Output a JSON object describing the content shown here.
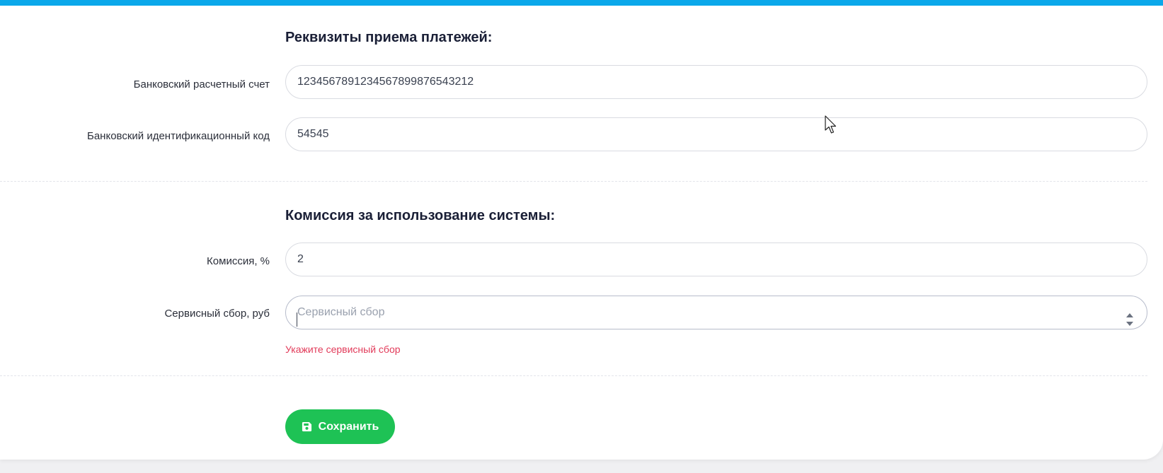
{
  "colors": {
    "accent_bar": "#0ba8ea",
    "save_button": "#1ec255",
    "error": "#e23b5a"
  },
  "payment_details": {
    "title": "Реквизиты приема платежей:",
    "account_label": "Банковский расчетный счет",
    "account_value": "12345678912345678998765432​12",
    "bic_label": "Банковский идентификационный код",
    "bic_value": "54545"
  },
  "commission": {
    "title": "Комиссия за использование системы:",
    "percent_label": "Комиссия, %",
    "percent_value": "2",
    "fee_label": "Сервисный сбор, руб",
    "fee_value": "",
    "fee_placeholder": "Сервисный сбор",
    "fee_error": "Укажите сервисный сбор"
  },
  "actions": {
    "save_label": "Сохранить",
    "save_icon": "floppy-disk-icon"
  }
}
